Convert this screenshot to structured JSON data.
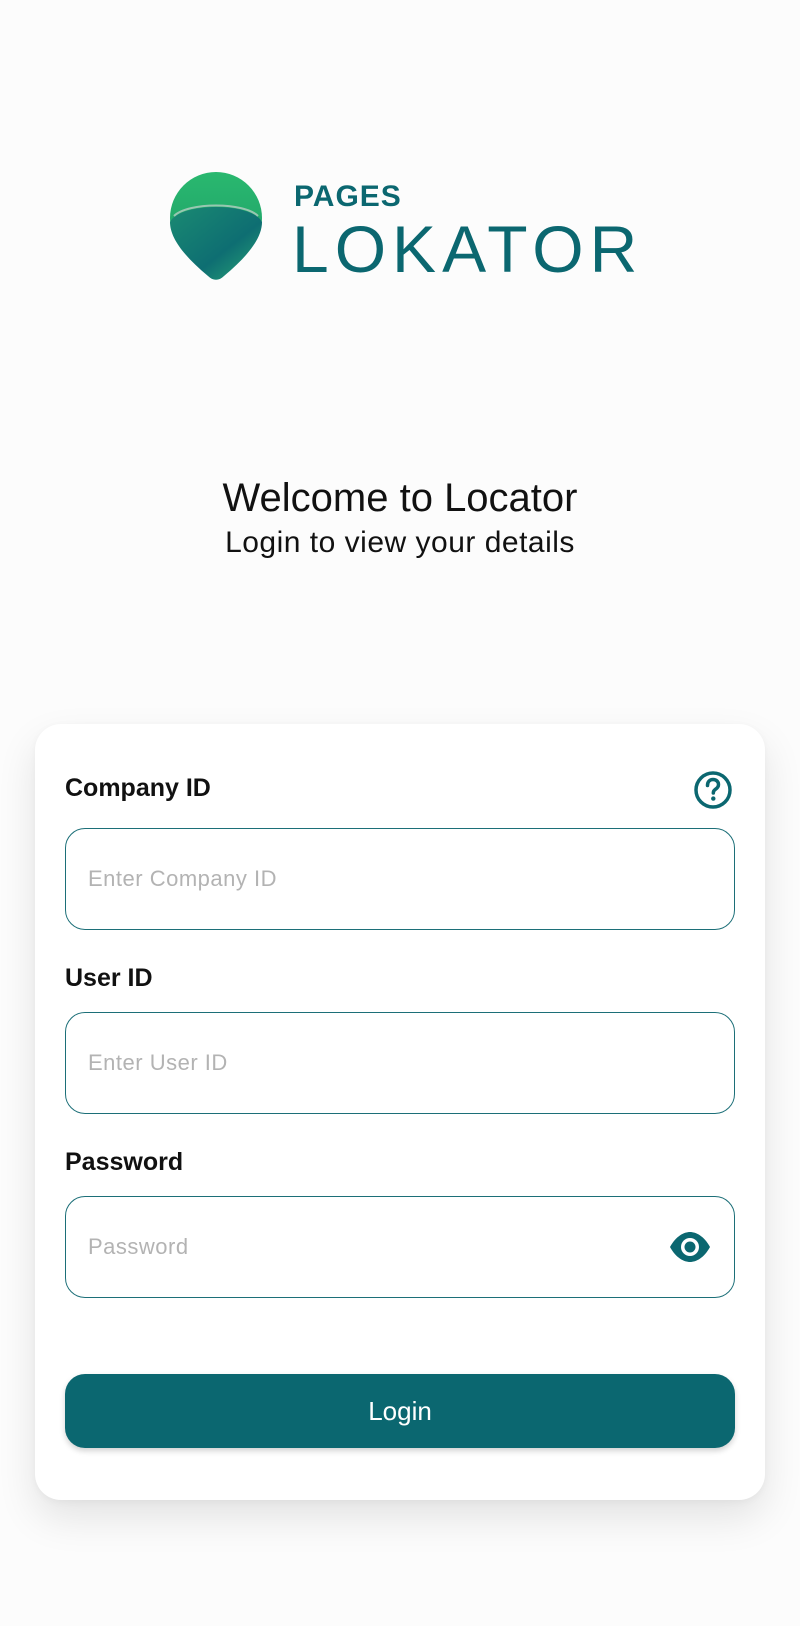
{
  "brand": {
    "small_text": "PAGES",
    "large_text": "LOKATOR",
    "logo_icon": "map-pin-logo-icon",
    "primary_color": "#0b6770",
    "gradient_top": "#27b56e",
    "gradient_bottom": "#0b6770"
  },
  "welcome": {
    "title": "Welcome to Locator",
    "subtitle": "Login to view your details"
  },
  "form": {
    "company": {
      "label": "Company ID",
      "placeholder": "Enter Company ID",
      "value": "",
      "help_icon": "question-circle-icon"
    },
    "user": {
      "label": "User ID",
      "placeholder": "Enter User ID",
      "value": ""
    },
    "password": {
      "label": "Password",
      "placeholder": "Password",
      "value": "",
      "toggle_icon": "eye-icon"
    },
    "submit_label": "Login"
  }
}
